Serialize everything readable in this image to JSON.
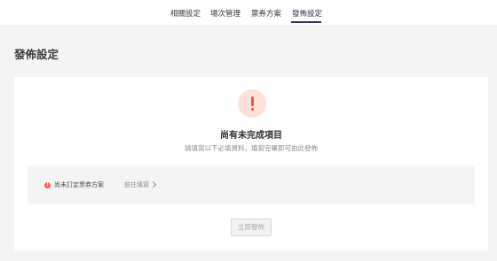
{
  "nav": {
    "tabs": [
      "相關設定",
      "場次管理",
      "票券方案",
      "發佈設定"
    ],
    "active_index": 3
  },
  "page": {
    "title": "發佈設定"
  },
  "status": {
    "icon": "warning-icon",
    "headline": "尚有未完成項目",
    "subline": "請填寫以下必填資料，填寫完畢即可由此發佈"
  },
  "todo": {
    "icon": "alert-icon",
    "icon_glyph": "!",
    "text": "尚未訂定票券方案",
    "link_label": "前往填寫"
  },
  "actions": {
    "publish_label": "立即發佈",
    "publish_enabled": false
  },
  "colors": {
    "accent": "#2f3552",
    "warning": "#e9583e",
    "warning_bg": "#fde0d8"
  }
}
